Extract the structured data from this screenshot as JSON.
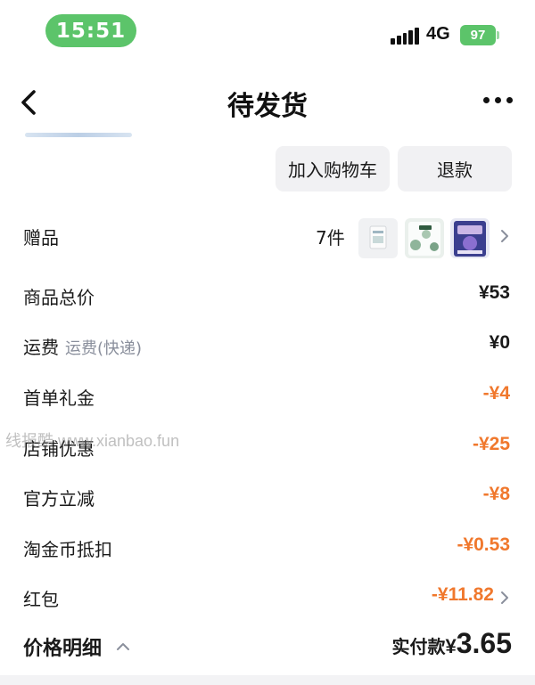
{
  "status_bar": {
    "time": "15:51",
    "network": "4G",
    "battery": "97"
  },
  "nav": {
    "title": "待发货"
  },
  "actions": {
    "add_to_cart": "加入购物车",
    "refund": "退款"
  },
  "gift": {
    "label": "赠品",
    "count": "7件"
  },
  "price_rows": [
    {
      "label": "商品总价",
      "value": "¥53"
    },
    {
      "label": "运费",
      "sublabel": "运费(快递)",
      "value": "¥0"
    },
    {
      "label": "首单礼金",
      "value": "-¥4"
    },
    {
      "label": "店铺优惠",
      "value": "-¥25"
    },
    {
      "label": "官方立减",
      "value": "-¥8"
    },
    {
      "label": "淘金币抵扣",
      "value": "-¥0.53"
    },
    {
      "label": "红包",
      "value": "-¥11.82"
    }
  ],
  "footer": {
    "detail_label": "价格明细",
    "paid_label": "实付款",
    "paid_symbol": "¥",
    "paid_amount": "3.65"
  },
  "watermark": "线报酷 www.xianbao.fun",
  "colors": {
    "accent_green": "#5cc46a",
    "discount_orange": "#f0782d",
    "button_bg": "#f1f1f3",
    "sublabel_gray": "#8a8f9c"
  },
  "icons": [
    "back-arrow-icon",
    "more-dots-icon",
    "chevron-right-icon",
    "chevron-up-icon",
    "signal-icon",
    "battery-icon"
  ]
}
